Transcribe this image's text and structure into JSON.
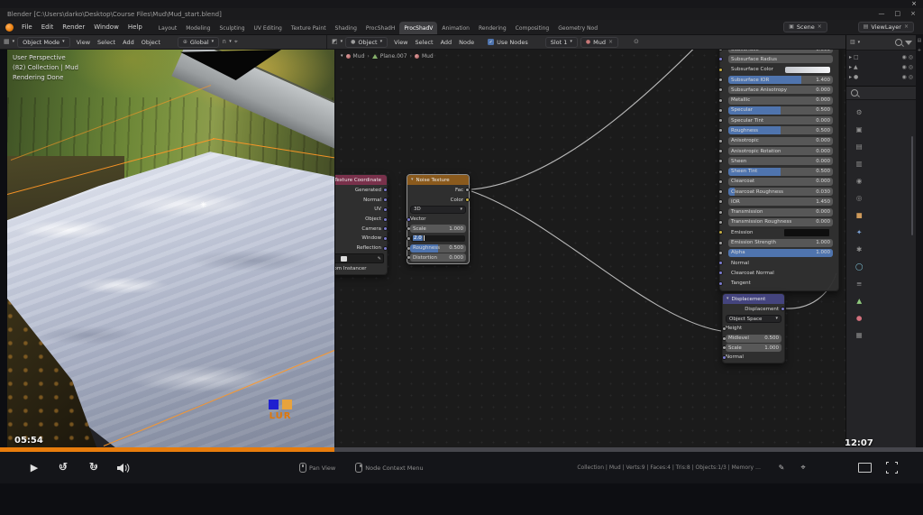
{
  "colors": {
    "accent_orange": "#e87d0d",
    "slider_blue": "#4f74ae",
    "selection_orange": "#ff9726"
  },
  "icons": {
    "close": "×",
    "minimize": "—",
    "maximize": "□",
    "chevron": "▾",
    "caret": "›",
    "arrow": "▸",
    "check": "✓",
    "play": "▶",
    "skip_back": "↺",
    "skip_fwd": "↻",
    "skip_num": "10",
    "magnet": "∩",
    "globe": "⊕",
    "grid": "▦",
    "node_editor": "◩",
    "outliner": "▥",
    "sphere": "●",
    "pencil": "✎",
    "target": "⌖",
    "sparkle": "✳",
    "eye": "◉",
    "box": "□",
    "camera": "◎",
    "mesh": "▲",
    "layers": "▤",
    "scene": "▣",
    "pin": "⊙",
    "plus": "+"
  },
  "titlebar": {
    "title": "Blender   [C:\\Users\\darko\\Desktop\\Course Files\\Mud\\Mud_start.blend]"
  },
  "menubar": {
    "menus": [
      "File",
      "Edit",
      "Render",
      "Window",
      "Help"
    ],
    "workspaces": [
      {
        "label": "Layout",
        "cls": ""
      },
      {
        "label": "Modeling",
        "cls": ""
      },
      {
        "label": "Sculpting",
        "cls": ""
      },
      {
        "label": "UV Editing",
        "cls": ""
      },
      {
        "label": "Texture Paint",
        "cls": ""
      },
      {
        "label": "Shading",
        "cls": ""
      },
      {
        "label": "ProcShadH",
        "cls": ""
      },
      {
        "label": "ProcShadV",
        "cls": "active"
      },
      {
        "label": "Animation",
        "cls": ""
      },
      {
        "label": "Rendering",
        "cls": ""
      },
      {
        "label": "Compositing",
        "cls": ""
      },
      {
        "label": "Geometry Nod",
        "cls": ""
      }
    ],
    "scene": "Scene",
    "viewlayer": "ViewLayer"
  },
  "viewport_header": {
    "mode": "Object Mode",
    "menus": [
      "View",
      "Select",
      "Add",
      "Object"
    ],
    "orientation": "Global"
  },
  "node_header": {
    "type": "Object",
    "menus": [
      "View",
      "Select",
      "Add",
      "Node"
    ],
    "use_nodes": "Use Nodes",
    "slot": "Slot 1",
    "material": "Mud"
  },
  "breadcrumb": {
    "items": [
      "Mud",
      "Plane.007",
      "Mud"
    ]
  },
  "viewport": {
    "overlay": [
      "User Perspective",
      "(82) Collection | Mud",
      "Rendering Done"
    ],
    "watermark": "LUR"
  },
  "nodes": {
    "texcoord": {
      "title": "Texture Coordinate",
      "outputs": [
        "Generated",
        "Normal",
        "UV",
        "Object",
        "Camera",
        "Window",
        "Reflection"
      ],
      "from_instancer": "From Instancer"
    },
    "noise": {
      "title": "Noise Texture",
      "fac": "Fac",
      "color": "Color",
      "dimensions": "3D",
      "vector": "Vector",
      "scale": {
        "label": "Scale",
        "value": "1.000"
      },
      "detail_edit": "2.0",
      "roughness": {
        "label": "Roughness",
        "value": "0.500",
        "fill": 50
      },
      "distortion": {
        "label": "Distortion",
        "value": "0.000"
      }
    },
    "principled": {
      "rows": [
        {
          "label": "Subsurface",
          "value": "0.000",
          "fill": 0,
          "sock": "sock-gray",
          "cls": ""
        },
        {
          "label": "Subsurface Radius",
          "value": "",
          "fill": 0,
          "sock": "sock-violet",
          "cls": ""
        },
        {
          "label": "Subsurface Color",
          "value": "",
          "fill": 0,
          "sock": "sock-yellow",
          "cls": "trow-color"
        },
        {
          "label": "Subsurface IOR",
          "value": "1.400",
          "fill": 70,
          "sock": "sock-gray",
          "cls": ""
        },
        {
          "label": "Subsurface Anisotropy",
          "value": "0.000",
          "fill": 0,
          "sock": "sock-gray",
          "cls": ""
        },
        {
          "label": "Metallic",
          "value": "0.000",
          "fill": 0,
          "sock": "sock-gray",
          "cls": ""
        },
        {
          "label": "Specular",
          "value": "0.500",
          "fill": 50,
          "sock": "sock-gray",
          "cls": ""
        },
        {
          "label": "Specular Tint",
          "value": "0.000",
          "fill": 0,
          "sock": "sock-gray",
          "cls": ""
        },
        {
          "label": "Roughness",
          "value": "0.500",
          "fill": 50,
          "sock": "sock-gray",
          "cls": ""
        },
        {
          "label": "Anisotropic",
          "value": "0.000",
          "fill": 0,
          "sock": "sock-gray",
          "cls": ""
        },
        {
          "label": "Anisotropic Rotation",
          "value": "0.000",
          "fill": 0,
          "sock": "sock-gray",
          "cls": ""
        },
        {
          "label": "Sheen",
          "value": "0.000",
          "fill": 0,
          "sock": "sock-gray",
          "cls": ""
        },
        {
          "label": "Sheen Tint",
          "value": "0.500",
          "fill": 50,
          "sock": "sock-gray",
          "cls": ""
        },
        {
          "label": "Clearcoat",
          "value": "0.000",
          "fill": 0,
          "sock": "sock-gray",
          "cls": ""
        },
        {
          "label": "Clearcoat Roughness",
          "value": "0.030",
          "fill": 6,
          "sock": "sock-gray",
          "cls": ""
        },
        {
          "label": "IOR",
          "value": "1.450",
          "fill": 0,
          "sock": "sock-gray",
          "cls": ""
        },
        {
          "label": "Transmission",
          "value": "0.000",
          "fill": 0,
          "sock": "sock-gray",
          "cls": ""
        },
        {
          "label": "Transmission Roughness",
          "value": "0.000",
          "fill": 0,
          "sock": "sock-gray",
          "cls": ""
        },
        {
          "label": "Emission",
          "value": "",
          "fill": 0,
          "sock": "sock-yellow",
          "cls": "trow-colordark"
        },
        {
          "label": "Emission Strength",
          "value": "1.000",
          "fill": 0,
          "sock": "sock-gray",
          "cls": ""
        },
        {
          "label": "Alpha",
          "value": "1.000",
          "fill": 100,
          "sock": "sock-gray",
          "cls": ""
        },
        {
          "label": "Normal",
          "value": "",
          "fill": 0,
          "sock": "sock-violet",
          "cls": "trow-label"
        },
        {
          "label": "Clearcoat Normal",
          "value": "",
          "fill": 0,
          "sock": "sock-violet",
          "cls": "trow-label"
        },
        {
          "label": "Tangent",
          "value": "",
          "fill": 0,
          "sock": "sock-violet",
          "cls": "trow-label"
        }
      ]
    },
    "displacement": {
      "title": "Displacement",
      "output": "Displacement",
      "space": "Object Space",
      "height": "Height",
      "midlevel": {
        "label": "Midlevel",
        "value": "0.500"
      },
      "scale": {
        "label": "Scale",
        "value": "1.000"
      },
      "normal": "Normal"
    }
  },
  "properties_tabs": [
    {
      "name": "tool",
      "glyph": "⚙",
      "color": "#909090"
    },
    {
      "name": "render",
      "glyph": "▣",
      "color": "#909090"
    },
    {
      "name": "output",
      "glyph": "▤",
      "color": "#909090"
    },
    {
      "name": "view-layer",
      "glyph": "▥",
      "color": "#909090"
    },
    {
      "name": "scene",
      "glyph": "◉",
      "color": "#909090"
    },
    {
      "name": "world",
      "glyph": "◎",
      "color": "#909090"
    },
    {
      "name": "object",
      "glyph": "■",
      "color": "#cf9a5a"
    },
    {
      "name": "modifiers",
      "glyph": "✦",
      "color": "#7da4d8"
    },
    {
      "name": "particles",
      "glyph": "✱",
      "color": "#909090"
    },
    {
      "name": "physics",
      "glyph": "◯",
      "color": "#7fc4d8"
    },
    {
      "name": "constraints",
      "glyph": "≡",
      "color": "#909090"
    },
    {
      "name": "object-data",
      "glyph": "▲",
      "color": "#8fc97d"
    },
    {
      "name": "material",
      "glyph": "●",
      "color": "#d4707d"
    },
    {
      "name": "texture",
      "glyph": "▦",
      "color": "#909090"
    }
  ],
  "player": {
    "current": "05:54",
    "total": "12:07",
    "progress_pct": 36.2
  },
  "statusbar": {
    "hints": [
      {
        "label": "Pan View",
        "btn": "mid"
      },
      {
        "label": "Node Context Menu",
        "btn": "right"
      }
    ],
    "stats": "Collection | Mud | Verts:9 | Faces:4 | Tris:8 | Objects:1/3 | Memory …"
  }
}
